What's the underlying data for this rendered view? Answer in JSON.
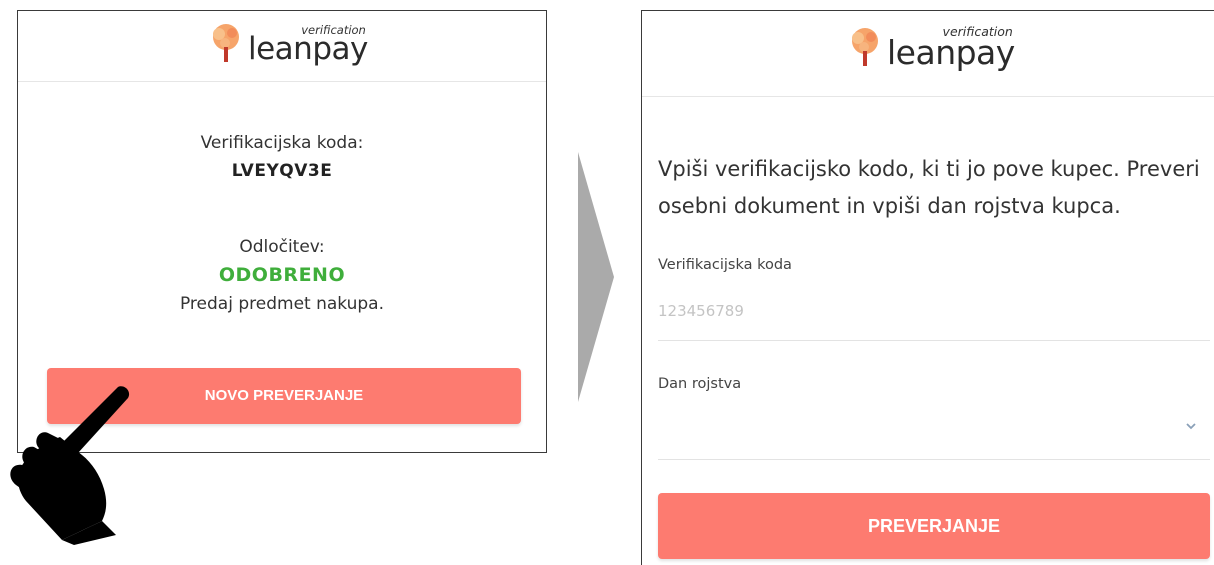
{
  "logo": {
    "word": "leanpay",
    "sub": "verification"
  },
  "left_panel": {
    "code_label": "Verifikacijska koda:",
    "code_value": "LVEYQV3E",
    "decision_label": "Odločitev:",
    "decision_value": "ODOBRENO",
    "instruction": "Predaj predmet nakupa.",
    "button_label": "NOVO PREVERJANJE"
  },
  "right_panel": {
    "instruction_line1": "Vpiši verifikacijsko kodo, ki ti jo pove kupec. Preveri",
    "instruction_line2": "osebni dokument in vpiši dan rojstva kupca.",
    "code_field": {
      "label": "Verifikacijska koda",
      "placeholder": "123456789"
    },
    "birth_field": {
      "label": "Dan rojstva",
      "value": ""
    },
    "button_label": "PREVERJANJE"
  },
  "colors": {
    "button": "#fd7b70",
    "approved": "#3fae3b",
    "arrow": "#aaaaaa",
    "hand": "#000000"
  },
  "icons": [
    "leanpay-tree-logo-icon",
    "chevron-down-icon",
    "arrow-right-icon",
    "pointing-hand-icon"
  ]
}
